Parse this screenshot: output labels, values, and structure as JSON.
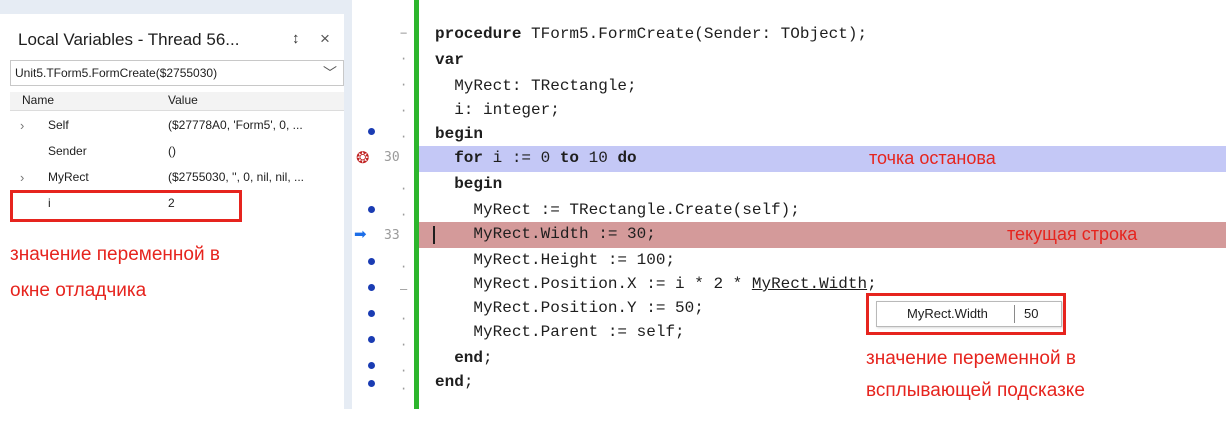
{
  "locals": {
    "title": "Local Variables - Thread 56...",
    "pin_glyph": "↕",
    "close_glyph": "×",
    "frame": "Unit5.TForm5.FormCreate($2755030)",
    "columns": {
      "name": "Name",
      "value": "Value"
    },
    "rows": [
      {
        "expander": "›",
        "name": "Self",
        "value": "($27778A0, 'Form5', 0, ..."
      },
      {
        "expander": "",
        "name": "Sender",
        "value": "()"
      },
      {
        "expander": "›",
        "name": "MyRect",
        "value": "($2755030, '', 0, nil, nil, ..."
      },
      {
        "expander": "",
        "name": "i",
        "value": "2"
      }
    ],
    "note_line1": "значение переменной в",
    "note_line2": "окне отладчика"
  },
  "editor": {
    "line_numbers": {
      "breakpoint": "30",
      "current": "33"
    },
    "code_lines": [
      {
        "kw": "procedure",
        "rest": " TForm5.FormCreate(Sender: TObject);"
      },
      {
        "kw": "var",
        "rest": ""
      },
      {
        "kw": "",
        "rest": "  MyRect: TRectangle;"
      },
      {
        "kw": "",
        "rest": "  i: integer;"
      },
      {
        "kw": "begin",
        "rest": ""
      },
      {
        "kw": "",
        "rest": ""
      },
      {
        "kw": "  begin",
        "rest": ""
      },
      {
        "kw": "",
        "rest": "    MyRect := TRectangle.Create(self);"
      },
      {
        "kw": "",
        "rest": "    MyRect.Width := 30;"
      },
      {
        "kw": "",
        "rest": "    MyRect.Height := 100;"
      },
      {
        "kw": "",
        "rest": ""
      },
      {
        "kw": "",
        "rest": "    MyRect.Position.Y := 50;"
      },
      {
        "kw": "",
        "rest": "    MyRect.Parent := self;"
      },
      {
        "kw": "  end",
        "rest": ";"
      },
      {
        "kw": "end",
        "rest": ";"
      }
    ],
    "for_line": {
      "a": "  for",
      "b": " i := 0 ",
      "c": "to",
      "d": " 10 ",
      "e": "do"
    },
    "posx_line": {
      "a": "    MyRect.Position.X := i * 2 * ",
      "b": "MyRect.Width",
      "c": ";"
    },
    "breakpoint_note": "точка останова",
    "current_note": "текущая строка",
    "tooltip": {
      "name": "MyRect.Width",
      "value": "50"
    },
    "tooltip_note_line1": "значение переменной в",
    "tooltip_note_line2": "всплывающей подсказке"
  },
  "colors": {
    "annotation_red": "#e6241e",
    "breakpoint_highlight": "#c4c8f6",
    "current_line_highlight": "#d49a9a",
    "modified_bar": "#2db52d"
  },
  "icons": [
    "pin-icon",
    "close-icon",
    "chevron-down-icon",
    "breakpoint-icon",
    "execution-point-icon"
  ]
}
